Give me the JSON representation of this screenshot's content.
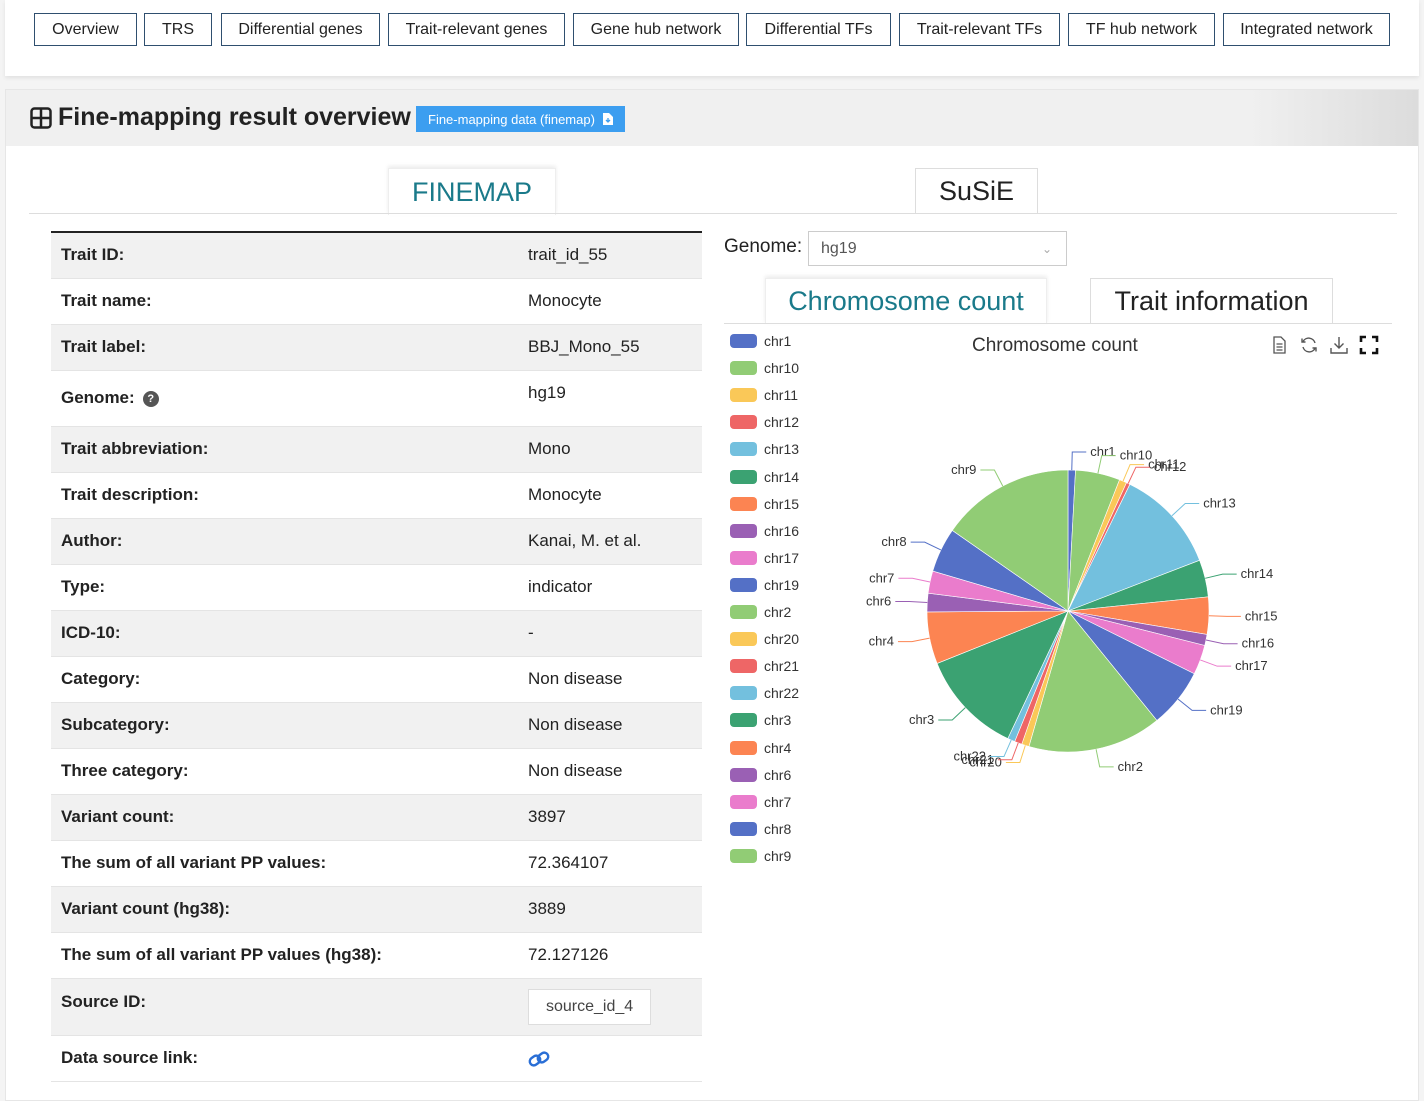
{
  "nav": {
    "items": [
      "Overview",
      "TRS",
      "Differential genes",
      "Trait-relevant genes",
      "Gene hub network",
      "Differential TFs",
      "Trait-relevant TFs",
      "TF hub network",
      "Integrated network"
    ]
  },
  "panel": {
    "title": "Fine-mapping result overview",
    "download_label": "Fine-mapping data (finemap)"
  },
  "method_tabs": {
    "finemap": "FINEMAP",
    "susie": "SuSiE"
  },
  "info": {
    "trait_id_label": "Trait ID:",
    "trait_id": "trait_id_55",
    "trait_name_label": "Trait name:",
    "trait_name": "Monocyte",
    "trait_label_label": "Trait label:",
    "trait_label": "BBJ_Mono_55",
    "genome_label": "Genome:",
    "genome": "hg19",
    "abbr_label": "Trait abbreviation:",
    "abbr": "Mono",
    "desc_label": "Trait description:",
    "desc": "Monocyte",
    "author_label": "Author:",
    "author": "Kanai, M. et al.",
    "type_label": "Type:",
    "type": "indicator",
    "icd_label": "ICD-10:",
    "icd": "-",
    "category_label": "Category:",
    "category": "Non disease",
    "subcategory_label": "Subcategory:",
    "subcategory": "Non disease",
    "three_label": "Three category:",
    "three": "Non disease",
    "variant_count_label": "Variant count:",
    "variant_count": "3897",
    "pp_sum_label": "The sum of all variant PP values:",
    "pp_sum": "72.364107",
    "variant_count38_label": "Variant count (hg38):",
    "variant_count38": "3889",
    "pp_sum38_label": "The sum of all variant PP values (hg38):",
    "pp_sum38": "72.127126",
    "source_id_label": "Source ID:",
    "source_id": "source_id_4",
    "link_label": "Data source link:"
  },
  "genome_select": {
    "label": "Genome:",
    "value": "hg19"
  },
  "chart_tabs": {
    "chrom": "Chromosome count",
    "trait": "Trait information"
  },
  "chart_data": {
    "type": "pie",
    "title": "Chromosome count",
    "legend_position": "left",
    "slices": [
      {
        "name": "chr1",
        "value": 1.0,
        "color": "#5470c6"
      },
      {
        "name": "chr10",
        "value": 6.0,
        "color": "#91cc75"
      },
      {
        "name": "chr11",
        "value": 1.0,
        "color": "#fac858"
      },
      {
        "name": "chr12",
        "value": 0.5,
        "color": "#ee6666"
      },
      {
        "name": "chr13",
        "value": 14.0,
        "color": "#73c0de"
      },
      {
        "name": "chr14",
        "value": 5.0,
        "color": "#3ba272"
      },
      {
        "name": "chr15",
        "value": 5.0,
        "color": "#fc8452"
      },
      {
        "name": "chr16",
        "value": 1.5,
        "color": "#9a60b4"
      },
      {
        "name": "chr17",
        "value": 4.0,
        "color": "#ea7ccc"
      },
      {
        "name": "chr19",
        "value": 8.0,
        "color": "#5470c6"
      },
      {
        "name": "chr2",
        "value": 18.0,
        "color": "#91cc75"
      },
      {
        "name": "chr20",
        "value": 1.0,
        "color": "#fac858"
      },
      {
        "name": "chr21",
        "value": 1.0,
        "color": "#ee6666"
      },
      {
        "name": "chr22",
        "value": 1.0,
        "color": "#73c0de"
      },
      {
        "name": "chr3",
        "value": 14.0,
        "color": "#3ba272"
      },
      {
        "name": "chr4",
        "value": 7.0,
        "color": "#fc8452"
      },
      {
        "name": "chr6",
        "value": 2.5,
        "color": "#9a60b4"
      },
      {
        "name": "chr7",
        "value": 3.0,
        "color": "#ea7ccc"
      },
      {
        "name": "chr8",
        "value": 6.0,
        "color": "#5470c6"
      },
      {
        "name": "chr9",
        "value": 18.0,
        "color": "#91cc75"
      }
    ]
  }
}
